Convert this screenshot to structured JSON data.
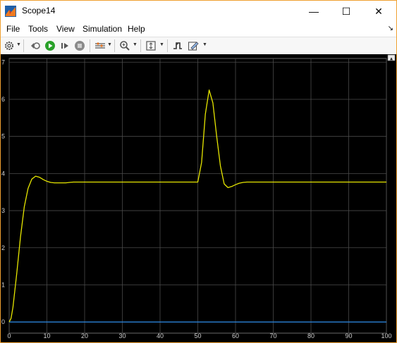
{
  "window": {
    "title": "Scope14",
    "minimize_glyph": "—",
    "maximize_glyph": "☐",
    "close_glyph": "✕"
  },
  "menu": {
    "items": [
      "File",
      "Tools",
      "View",
      "Simulation",
      "Help"
    ],
    "overflow_glyph": "↘"
  },
  "toolbar": {
    "icons": [
      "gear-icon",
      "restore-icon",
      "run-icon",
      "step-forward-icon",
      "stop-icon",
      "style-icon",
      "zoom-icon",
      "scale-axes-icon",
      "triggers-icon",
      "edit-icon"
    ],
    "colors": {
      "run": "#2aa12a",
      "stop": "#8a8a8a"
    }
  },
  "scope": {
    "background": "#000000",
    "grid_color": "#4a4a4a",
    "tick_color": "#cfcfcf",
    "undock_glyph": "▴"
  },
  "chart_data": {
    "type": "line",
    "title": "",
    "xlabel": "",
    "ylabel": "",
    "xlim": [
      0,
      100
    ],
    "ylim": [
      -0.3,
      7.1
    ],
    "xticks": [
      0,
      10,
      20,
      30,
      40,
      50,
      60,
      70,
      80,
      90,
      100
    ],
    "yticks": [
      0,
      1,
      2,
      3,
      4,
      5,
      6,
      7
    ],
    "grid": true,
    "series": [
      {
        "color": "#e6e600",
        "x": [
          0,
          0.5,
          1,
          2,
          3,
          4,
          5,
          6,
          7,
          8,
          9,
          10,
          11,
          12,
          13,
          14,
          15,
          16,
          17,
          18,
          20,
          30,
          40,
          50,
          51,
          52,
          53,
          54,
          55,
          56,
          57,
          58,
          59,
          60,
          61,
          62,
          63,
          65,
          70,
          80,
          90,
          100
        ],
        "y": [
          0,
          0.1,
          0.4,
          1.3,
          2.3,
          3.1,
          3.6,
          3.85,
          3.93,
          3.9,
          3.84,
          3.79,
          3.76,
          3.75,
          3.75,
          3.75,
          3.75,
          3.76,
          3.77,
          3.77,
          3.77,
          3.77,
          3.77,
          3.77,
          4.3,
          5.6,
          6.25,
          5.9,
          5.0,
          4.2,
          3.72,
          3.62,
          3.65,
          3.7,
          3.74,
          3.76,
          3.77,
          3.77,
          3.77,
          3.77,
          3.77,
          3.77
        ]
      },
      {
        "color": "#2a7fd4",
        "x": [
          0,
          100
        ],
        "y": [
          0,
          0
        ]
      }
    ]
  }
}
